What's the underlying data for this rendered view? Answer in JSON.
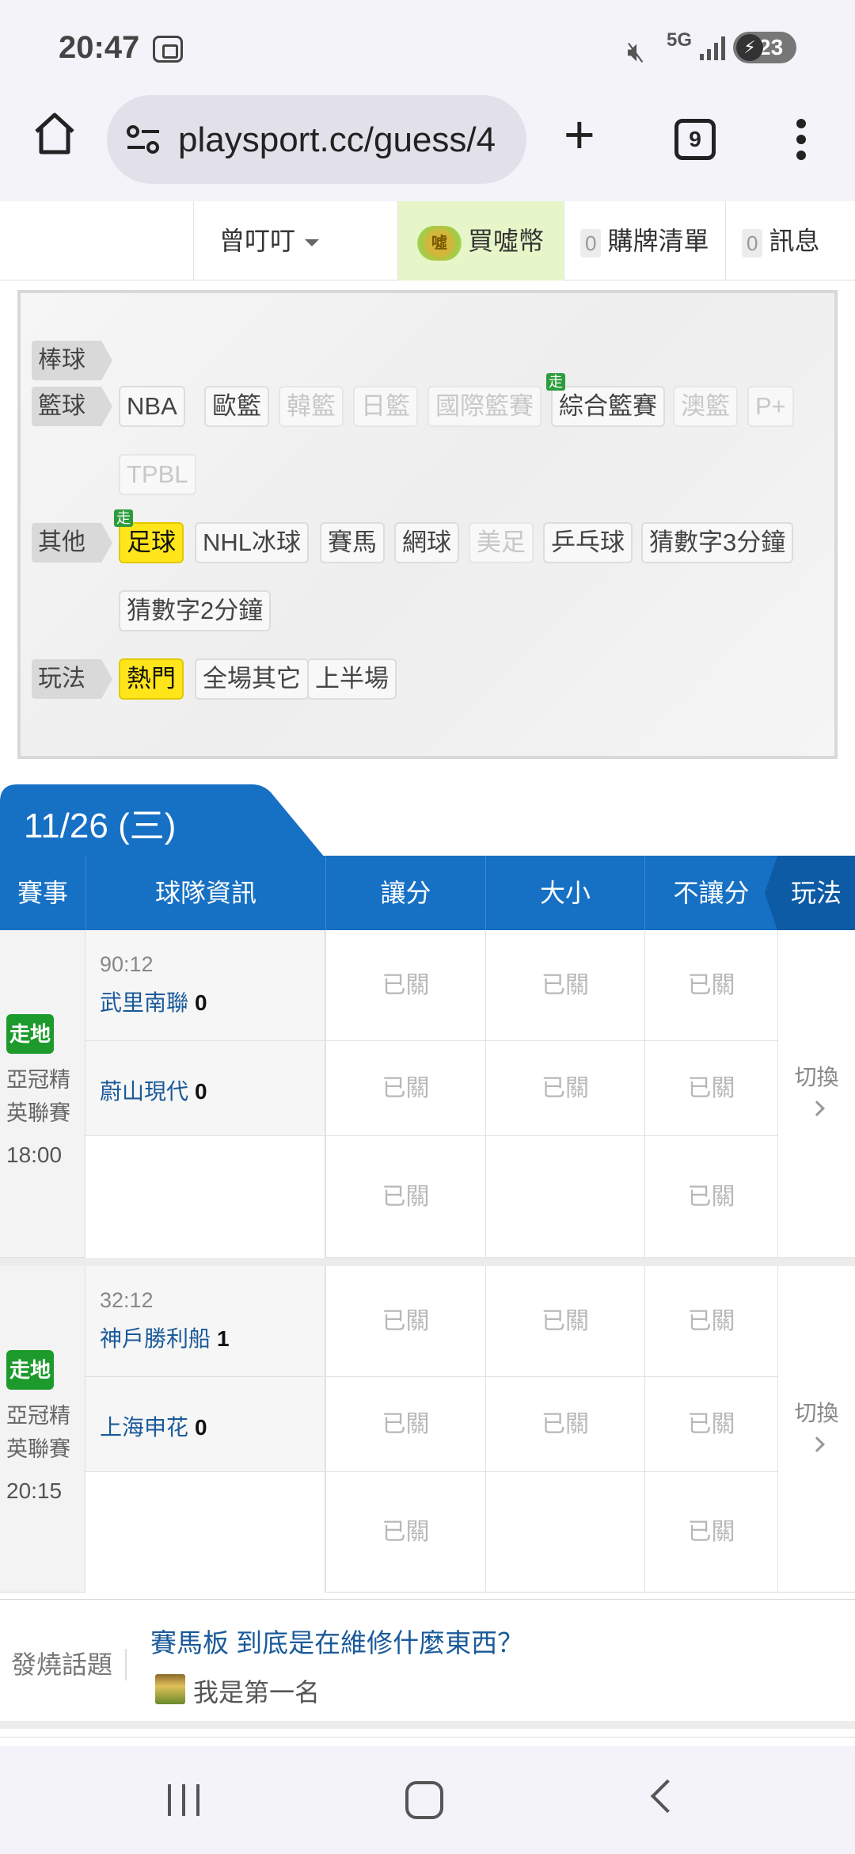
{
  "status": {
    "time": "20:47",
    "network": "5G",
    "battery": "23"
  },
  "browser": {
    "url": "playsport.cc/guess/4",
    "tab_count": "9"
  },
  "nav": {
    "user": "曾叮叮",
    "buy_label": "買噓幣",
    "coin_glyph": "噓",
    "cart_count": "0",
    "cart_label": "購牌清單",
    "msg_count": "0",
    "msg_label": "訊息"
  },
  "categories": {
    "baseball": {
      "label": "棒球"
    },
    "basketball": {
      "label": "籃球",
      "items": [
        "NBA",
        "歐籃",
        "韓籃",
        "日籃",
        "國際籃賽",
        "綜合籃賽",
        "澳籃",
        "P+",
        "TPBL"
      ]
    },
    "other": {
      "label": "其他",
      "items": [
        "足球",
        "NHL冰球",
        "賽馬",
        "網球",
        "美足",
        "乒乓球",
        "猜數字3分鐘",
        "猜數字2分鐘"
      ]
    },
    "play": {
      "label": "玩法",
      "items": [
        "熱門",
        "全場其它",
        "上半場"
      ]
    },
    "walk_tag": "走"
  },
  "date_label": "11/26 (三)",
  "table_header": {
    "event": "賽事",
    "team_info": "球隊資訊",
    "spread": "讓分",
    "total": "大小",
    "moneyline": "不讓分",
    "play": "玩法"
  },
  "matches": [
    {
      "live": "走地",
      "league": "亞冠精英聯賽",
      "time": "18:00",
      "clock": "90:12",
      "home": "武里南聯",
      "home_score": "0",
      "away": "蔚山現代",
      "away_score": "0",
      "closed": "已關",
      "switch": "切換"
    },
    {
      "live": "走地",
      "league": "亞冠精英聯賽",
      "time": "20:15",
      "clock": "32:12",
      "home": "神戶勝利船",
      "home_score": "1",
      "away": "上海申花",
      "away_score": "0",
      "closed": "已關",
      "switch": "切換"
    }
  ],
  "topic": {
    "label": "發燒話題",
    "title": "賽馬板 到底是在維修什麼東西？",
    "author": "我是第一名"
  },
  "colors": {
    "header_blue": "#1670c4",
    "live_green": "#1d9a2c",
    "hot_yellow": "#ffe51a",
    "link_blue": "#1a5a9a"
  }
}
